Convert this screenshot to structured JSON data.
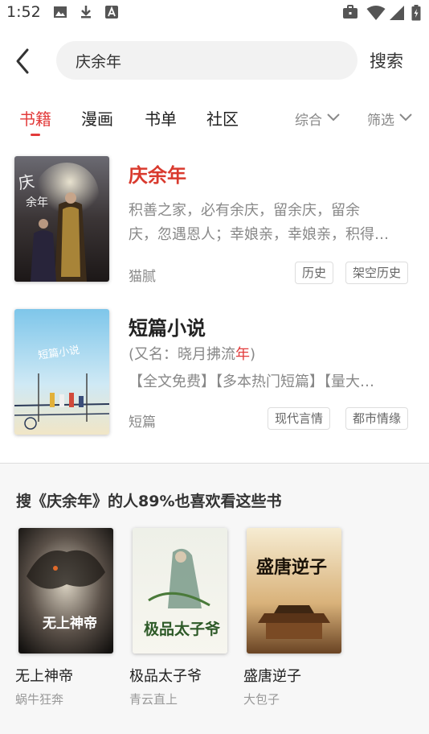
{
  "status_bar": {
    "time": "1:52"
  },
  "search": {
    "query": "庆余年",
    "button_label": "搜索"
  },
  "tabs": [
    {
      "label": "书籍",
      "active": true
    },
    {
      "label": "漫画",
      "active": false
    },
    {
      "label": "书单",
      "active": false
    },
    {
      "label": "社区",
      "active": false
    }
  ],
  "filters": {
    "sort_label": "综合",
    "filter_label": "筛选"
  },
  "results": [
    {
      "title": "庆余年",
      "desc_line1": "积善之家，必有余庆，留余庆，留余",
      "desc_line2": "庆，忽遇恩人；幸娘亲，幸娘亲，积得…",
      "author": "猫腻",
      "tags": [
        "历史",
        "架空历史"
      ]
    },
    {
      "title": "短篇小说",
      "alias_prefix": "(又名：晓月拂流",
      "alias_highlight": "年",
      "alias_suffix": ")",
      "desc_line1": "【全文免费】【多本热门短篇】【量大…",
      "author": "短篇",
      "tags": [
        "现代言情",
        "都市情缘"
      ]
    }
  ],
  "recommend": {
    "title": "搜《庆余年》的人89%也喜欢看这些书",
    "books": [
      {
        "name": "无上神帝",
        "author": "蜗牛狂奔",
        "cover_text": "无上神帝"
      },
      {
        "name": "极品太子爷",
        "author": "青云直上",
        "cover_text": "极品太子爷"
      },
      {
        "name": "盛唐逆子",
        "author": "大包子",
        "cover_text": "盛唐逆子"
      }
    ]
  },
  "colors": {
    "accent": "#e23b3b",
    "title_red": "#d93a2e"
  }
}
